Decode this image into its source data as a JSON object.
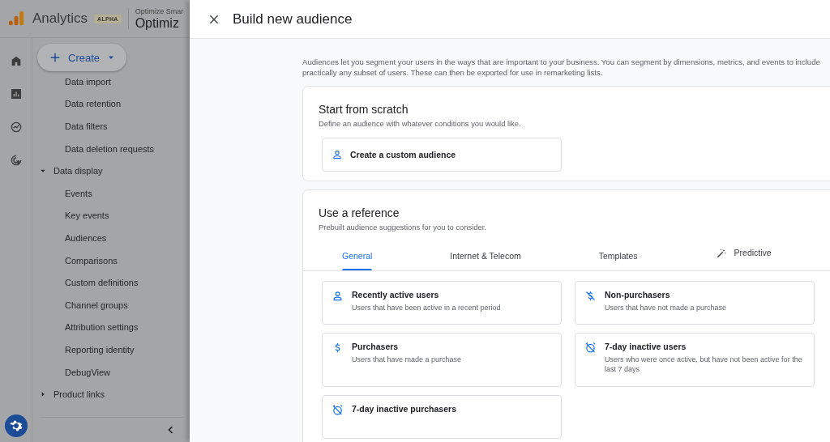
{
  "app": {
    "product": "Analytics",
    "badge": "ALPHA",
    "account": "Optimize Smar",
    "property": "Optimiz"
  },
  "rail": [
    {
      "kind": "home",
      "selected": false
    },
    {
      "kind": "reports",
      "selected": false
    },
    {
      "kind": "explore",
      "selected": false
    },
    {
      "kind": "advertising",
      "selected": false
    },
    {
      "kind": "admin",
      "selected": true
    }
  ],
  "create_button": {
    "label": "Create"
  },
  "nav": [
    {
      "label": "Data import"
    },
    {
      "label": "Data retention"
    },
    {
      "label": "Data filters"
    },
    {
      "label": "Data deletion requests"
    },
    {
      "label": "Data display",
      "expanded": true,
      "children": [
        {
          "label": "Events"
        },
        {
          "label": "Key events"
        },
        {
          "label": "Audiences"
        },
        {
          "label": "Comparisons"
        },
        {
          "label": "Custom definitions"
        },
        {
          "label": "Channel groups"
        },
        {
          "label": "Attribution settings"
        },
        {
          "label": "Reporting identity"
        },
        {
          "label": "DebugView"
        }
      ]
    },
    {
      "label": "Product links",
      "expanded": false
    }
  ],
  "panel": {
    "title": "Build new audience",
    "intro": "Audiences let you segment your users in the ways that are important to your business. You can segment by dimensions, metrics, and events to include practically any subset of users. These can then be exported for use in remarketing lists.",
    "scratch": {
      "title": "Start from scratch",
      "subtitle": "Define an audience with whatever conditions you would like.",
      "option": {
        "label": "Create a custom audience",
        "kind": "user"
      }
    },
    "reference": {
      "title": "Use a reference",
      "subtitle": "Prebuilt audience suggestions for you to consider.",
      "tabs": [
        {
          "label": "General",
          "selected": true
        },
        {
          "label": "Internet & Telecom",
          "selected": false
        },
        {
          "label": "Templates",
          "selected": false
        },
        {
          "label": "Predictive",
          "selected": false,
          "kind": "predictive"
        }
      ],
      "suggestions": [
        {
          "title": "Recently active users",
          "description": "Users that have been active in a recent period",
          "kind": "user"
        },
        {
          "title": "Non-purchasers",
          "description": "Users that have not made a purchase",
          "kind": "non-purchase"
        },
        {
          "title": "Purchasers",
          "description": "Users that have made a purchase",
          "kind": "purchase"
        },
        {
          "title": "7-day inactive users",
          "description": "Users who were once active, but have not been active for the last 7 days",
          "kind": "inactive"
        },
        {
          "title": "7-day inactive purchasers",
          "kind": "inactive"
        }
      ]
    }
  }
}
